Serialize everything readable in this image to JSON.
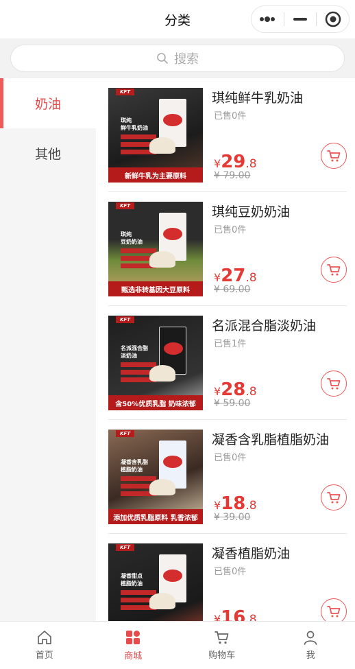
{
  "header": {
    "title": "分类"
  },
  "search": {
    "placeholder": "搜索"
  },
  "sidebar": {
    "items": [
      {
        "label": "奶油"
      },
      {
        "label": "其他"
      }
    ]
  },
  "products": [
    {
      "name": "琪纯鲜牛乳奶油",
      "sold": "已售0件",
      "currency": "¥",
      "price_int": "29",
      "price_dec": ".8",
      "original": "¥ 79.00",
      "image_text": "琪纯\n鲜牛乳奶油",
      "banner": "新鲜牛乳为主要原料",
      "logo": "KFT"
    },
    {
      "name": "琪纯豆奶奶油",
      "sold": "已售0件",
      "currency": "¥",
      "price_int": "27",
      "price_dec": ".8",
      "original": "¥ 69.00",
      "image_text": "琪纯\n豆奶奶油",
      "banner": "甄选非转基因大豆原料",
      "logo": "KFT"
    },
    {
      "name": "名派混合脂淡奶油",
      "sold": "已售1件",
      "currency": "¥",
      "price_int": "28",
      "price_dec": ".8",
      "original": "¥ 59.00",
      "image_text": "名派混合脂\n淡奶油",
      "banner": "含50%优质乳脂 奶味浓郁",
      "logo": "KFT"
    },
    {
      "name": "凝香含乳脂植脂奶油",
      "sold": "已售0件",
      "currency": "¥",
      "price_int": "18",
      "price_dec": ".8",
      "original": "¥ 39.00",
      "image_text": "凝香含乳脂\n植脂奶油",
      "banner": "添加优质乳脂原料 乳香浓郁",
      "logo": "KFT"
    },
    {
      "name": "凝香植脂奶油",
      "sold": "已售0件",
      "currency": "¥",
      "price_int": "16",
      "price_dec": ".8",
      "original": "",
      "image_text": "凝香甜点\n植脂奶油",
      "banner": "",
      "logo": "KFT"
    }
  ],
  "tabbar": {
    "items": [
      {
        "label": "首页"
      },
      {
        "label": "商城"
      },
      {
        "label": "购物车"
      },
      {
        "label": "我"
      }
    ]
  },
  "colors": {
    "accent": "#e84b4b",
    "banner": "#b51b1b"
  }
}
